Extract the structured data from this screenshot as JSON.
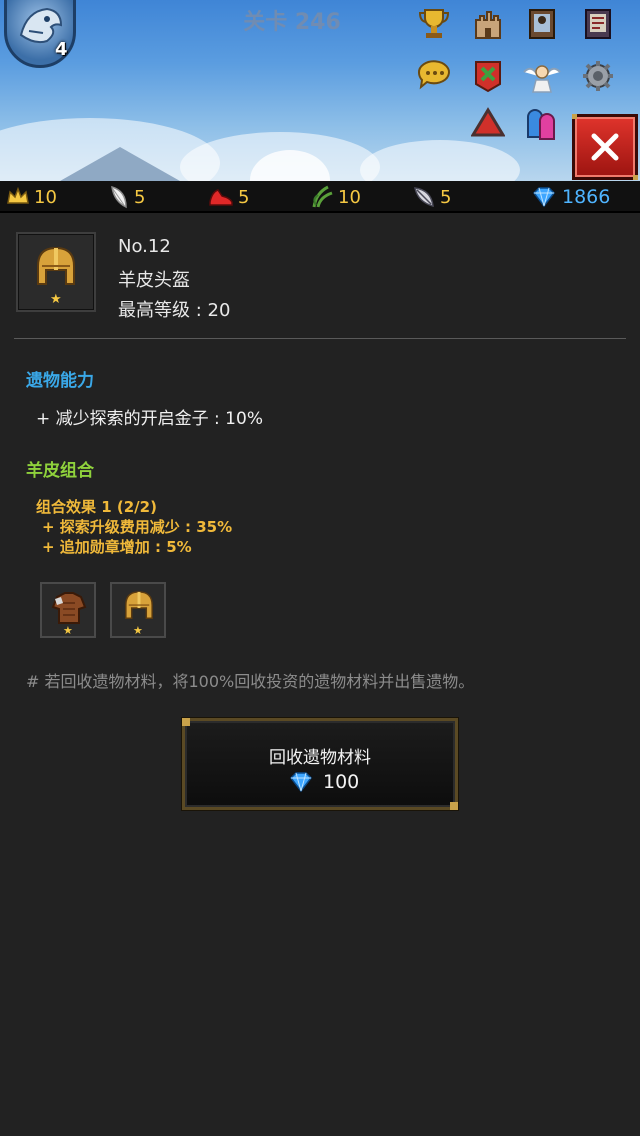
{
  "header": {
    "stage_title": "关卡 246",
    "player_level": "4"
  },
  "resources": [
    {
      "icon": "crown-icon",
      "value": "10"
    },
    {
      "icon": "feather-icon",
      "value": "5"
    },
    {
      "icon": "red-shoe-icon",
      "value": "5"
    },
    {
      "icon": "green-herb-icon",
      "value": "10"
    },
    {
      "icon": "dark-feather-icon",
      "value": "5"
    },
    {
      "icon": "diamond-icon",
      "value": "1866"
    }
  ],
  "item": {
    "number": "No.12",
    "name": "羊皮头盔",
    "max_level": "最高等级 : 20"
  },
  "ability": {
    "title": "遗物能力",
    "line": "+ 减少探索的开启金子 : 10%"
  },
  "set": {
    "title": "羊皮组合",
    "effect_title": "组合效果 1 (2/2)",
    "effect_lines": [
      "+ 探索升级费用减少 : 35%",
      "+ 追加勋章增加 : 5%"
    ]
  },
  "note": "# 若回收遗物材料，将100%回收投资的遗物材料并出售遗物。",
  "recycle_button": {
    "label": "回收遗物材料",
    "cost": "100"
  },
  "colors": {
    "background": "#222222",
    "ability_title": "#3aa8e8",
    "set_title": "#8fd13c",
    "set_text": "#f0b93a",
    "resource_value": "#f5c843",
    "gem_value": "#4fb4ff",
    "close_button": "#d32a22"
  }
}
